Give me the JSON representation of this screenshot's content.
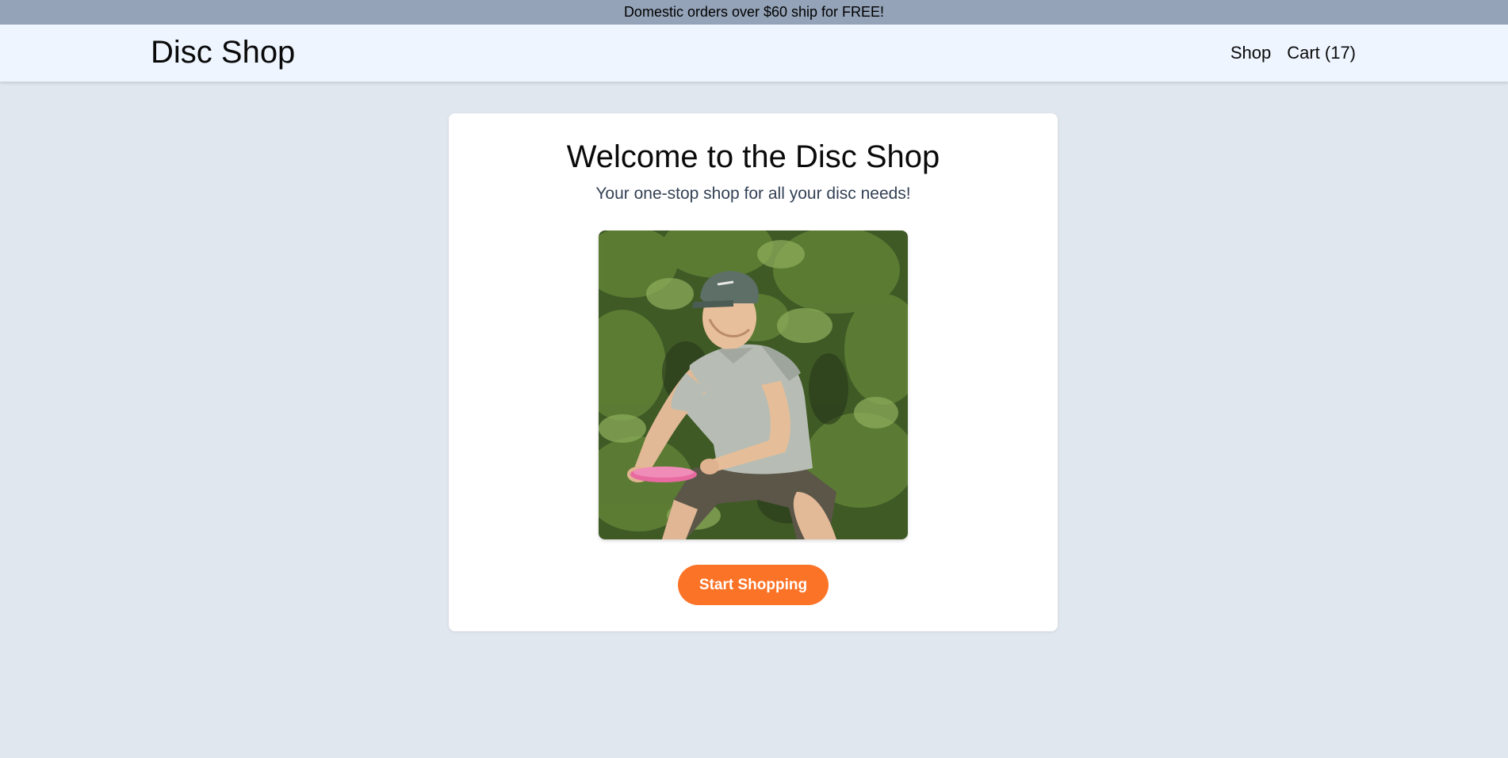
{
  "promo": {
    "text": "Domestic orders over $60 ship for FREE!"
  },
  "header": {
    "logo": "Disc Shop",
    "nav": [
      {
        "label": "Shop"
      },
      {
        "label": "Cart (17)"
      }
    ]
  },
  "main": {
    "title": "Welcome to the Disc Shop",
    "subtitle": "Your one-stop shop for all your disc needs!",
    "hero_image": {
      "description_icon": "photo-person-throwing-disc"
    },
    "cta_label": "Start Shopping"
  },
  "colors": {
    "background": "#e1e7ef",
    "promo_bar": "#94a3b8",
    "header": "#eef5ff",
    "accent": "#fb7326"
  }
}
